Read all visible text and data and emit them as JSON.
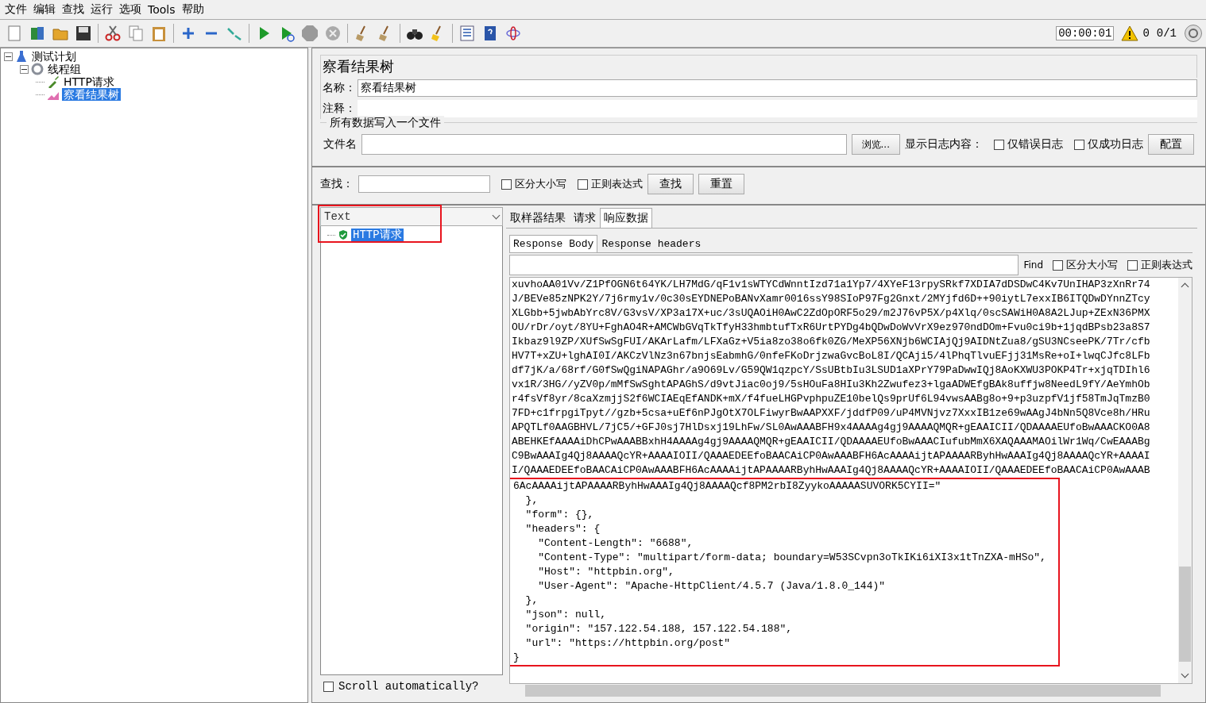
{
  "menu": [
    "文件",
    "编辑",
    "查找",
    "运行",
    "选项",
    "Tools",
    "帮助"
  ],
  "status": {
    "timer": "00:00:01",
    "warnings": "0",
    "threads": "0/1"
  },
  "tree": [
    {
      "label": "测试计划",
      "kind": "plan",
      "expanded": true,
      "selected": false,
      "children": [
        {
          "label": "线程组",
          "kind": "group",
          "expanded": true,
          "selected": false,
          "children": [
            {
              "label": "HTTP请求",
              "kind": "sampler",
              "selected": false
            },
            {
              "label": "察看结果树",
              "kind": "listener",
              "selected": true
            }
          ]
        }
      ]
    }
  ],
  "panel": {
    "title": "察看结果树",
    "name_label": "名称：",
    "name_value": "察看结果树",
    "comment_label": "注释：",
    "file_section": {
      "legend": "所有数据写入一个文件",
      "filename_label": "文件名",
      "browse": "浏览...",
      "log_label": "显示日志内容：",
      "options": [
        {
          "label": "仅错误日志",
          "checked": false
        },
        {
          "label": "仅成功日志",
          "checked": false
        }
      ],
      "configure": "配置"
    },
    "search": {
      "label": "查找：",
      "options": [
        {
          "label": "区分大小写",
          "checked": false
        },
        {
          "label": "正则表达式",
          "checked": false
        }
      ],
      "find": "查找",
      "reset": "重置"
    }
  },
  "results": {
    "renderer": "Text",
    "items": [
      {
        "label": "HTTP请求",
        "success": true,
        "selected": true
      }
    ],
    "scroll_auto": {
      "label": "Scroll automatically?",
      "checked": false
    }
  },
  "tabs": [
    {
      "label": "取样器结果",
      "selected": false
    },
    {
      "label": "请求",
      "selected": false
    },
    {
      "label": "响应数据",
      "selected": true
    }
  ],
  "subtabs": [
    {
      "label": "Response Body",
      "selected": true
    },
    {
      "label": "Response headers",
      "selected": false
    }
  ],
  "find": {
    "label": "Find",
    "options": [
      {
        "label": "区分大小写",
        "checked": false
      },
      {
        "label": "正则表达式",
        "checked": false
      }
    ]
  },
  "body_base64_lines": [
    "xuvhoAA01Vv/Z1PfOGN6t64YK/LH7MdG/qF1v1sWTYCdWnntIzd71a1Yp7/4XYeF13rpySRkf7XDIA7dDSDwC4Kv7UnIHAP3zXnRr74",
    "J/BEVe85zNPK2Y/7j6rmy1v/0c30sEYDNEPoBANvXamr0016ssY98SIoP97Fg2Gnxt/2MYjfd6D++90iytL7exxIB6ITQDwDYnnZTcy",
    "XLGbb+5jwbAbYrc8V/G3vsV/XP3a17X+uc/3sUQAOiH0AwC2ZdOpORF5o29/m2J76vP5X/p4Xlq/0scSAWiH0A8A2LJup+ZExN36PMX",
    "OU/rDr/oyt/8YU+FghAO4R+AMCWbGVqTkTfyH33hmbtufTxR6UrtPYDg4bQDwDoWvVrX9ez970ndDOm+Fvu0ci9b+1jqdBPsb23a8S7",
    "Ikbaz9l9ZP/XUfSwSgFUI/AKArLafm/LFXaGz+V5ia8zo38o6fk0ZG/MeXP56XNjb6WCIAjQj9AIDNtZua8/gSU3NCseePK/7Tr/cfb",
    "HV7T+xZU+lghAI0I/AKCzVlNz3n67bnjsEabmhG/0nfeFKoDrjzwaGvcBoL8I/QCAji5/4lPhqTlvuEFjj31MsRe+oI+lwqCJfc8LFb",
    "df7jK/a/68rf/G0fSwQgiNAPAGhr/a9O69Lv/G59QW1qzpcY/SsUBtbIu3LSUD1aXPrY79PaDwwIQj8AoKXWU3POKP4Tr+xjqTDIhl6",
    "vx1R/3HG//yZV0p/mMfSwSghtAPAGhS/d9vtJiac0oj9/5sHOuFa8HIu3Kh2Zwufez3+lgaADWEfgBAk8uffjw8NeedL9fY/AeYmhOb",
    "r4fsVf8yr/8caXzmjjS2f6WCIAEqEfANDK+mX/f4fueLHGPvphpuZE10belQs9prUf6L94vwsAABg8o+9+p3uzpfV1jf58TmJqTmzB0",
    "7FD+c1frpgiTpyt//gzb+5csa+uEf6nPJgOtX7OLFiwyrBwAAPXXF/jddfP09/uP4MVNjvz7XxxIB1ze69wAAgJ4bNn5Q8Vce8h/HRu",
    "APQTLf0AAGBHVL/7jC5/+GFJ0sj7HlDsxj19LhFw/SL0AwAAABFH9x4AAAAg4gj9AAAAQMQR+gEAAICII/QDAAAAEUfoBwAAACKO0A8",
    "ABEHKEfAAAAiDhCPwAAABBxhH4AAAAg4gj9AAAAQMQR+gEAAICII/QDAAAAEUfoBwAAACIufubMmX6XAQAAAMAOilWr1Wq/CwEAAABg",
    "C9BwAAAIg4Qj8AAAAQcYR+AAAAIOII/QAAAEDEEfoBAACAiCP0AwAAABFH6AcAAAAijtAPAAAARByhHwAAAIg4Qj8AAAAQcYR+AAAAI",
    "I/QAAAEDEEfoBAACAiCP0AwAAABFH6AcAAAAijtAPAAAARByhHwAAAIg4Qj8AAAAQcYR+AAAAIOII/QAAAEDEEfoBAACAiCP0AwAAAB"
  ],
  "body_json_lines": [
    "6AcAAAAijtAPAAAARByhHwAAAIg4Qj8AAAAQcf8PM2rbI8ZyykoAAAAASUVORK5CYII=\"",
    "  },",
    "  \"form\": {},",
    "  \"headers\": {",
    "    \"Content-Length\": \"6688\",",
    "    \"Content-Type\": \"multipart/form-data; boundary=W53SCvpn3oTkIKi6iXI3x1tTnZXA-mHSo\",",
    "    \"Host\": \"httpbin.org\",",
    "    \"User-Agent\": \"Apache-HttpClient/4.5.7 (Java/1.8.0_144)\"",
    "  },",
    "  \"json\": null,",
    "  \"origin\": \"157.122.54.188, 157.122.54.188\",",
    "  \"url\": \"https://httpbin.org/post\"",
    "}"
  ]
}
